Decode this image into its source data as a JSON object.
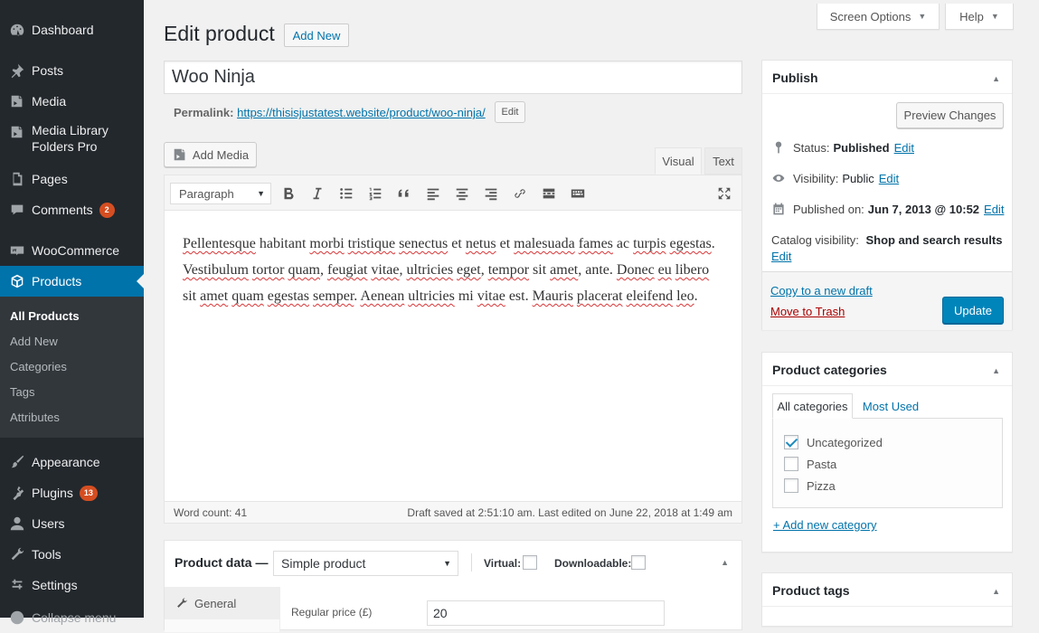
{
  "sidebar": {
    "items": [
      {
        "label": "Dashboard",
        "icon": "dashboard-icon"
      },
      {
        "label": "Posts",
        "icon": "pushpin-icon"
      },
      {
        "label": "Media",
        "icon": "media-icon"
      },
      {
        "label": "Media Library Folders Pro",
        "icon": "media-folders-icon"
      },
      {
        "label": "Pages",
        "icon": "pages-icon"
      },
      {
        "label": "Comments",
        "icon": "comment-icon",
        "badge": "2"
      },
      {
        "label": "WooCommerce",
        "icon": "woocommerce-icon"
      },
      {
        "label": "Products",
        "icon": "products-icon"
      },
      {
        "label": "Appearance",
        "icon": "paintbrush-icon"
      },
      {
        "label": "Plugins",
        "icon": "plugin-icon",
        "badge": "13"
      },
      {
        "label": "Users",
        "icon": "users-icon"
      },
      {
        "label": "Tools",
        "icon": "wrench-icon"
      },
      {
        "label": "Settings",
        "icon": "settings-icon"
      },
      {
        "label": "Collapse menu",
        "icon": "collapse-icon"
      }
    ],
    "media_library_line1": "Media Library",
    "media_library_line2": "Folders Pro",
    "submenu": [
      "All Products",
      "Add New",
      "Categories",
      "Tags",
      "Attributes"
    ]
  },
  "top": {
    "screen_options": "Screen Options",
    "help": "Help"
  },
  "header": {
    "title": "Edit product",
    "add_new": "Add New"
  },
  "post": {
    "title": "Woo Ninja",
    "permalink_label": "Permalink:",
    "permalink_url": "https://thisisjustatest.website/product/woo-ninja/",
    "permalink_edit": "Edit"
  },
  "editor": {
    "add_media": "Add Media",
    "tab_visual": "Visual",
    "tab_text": "Text",
    "format": "Paragraph",
    "word_count": "Word count: 41",
    "draft_saved": "Draft saved at 2:51:10 am. Last edited on June 22, 2018 at 1:49 am"
  },
  "product_data": {
    "title": "Product data —",
    "type": "Simple product",
    "virtual": "Virtual:",
    "downloadable": "Downloadable:",
    "general_tab": "General",
    "regular_price_label": "Regular price (£)",
    "regular_price": "20"
  },
  "publish": {
    "title": "Publish",
    "preview": "Preview Changes",
    "status_label": "Status:",
    "status_value": "Published",
    "visibility_label": "Visibility:",
    "visibility_value": "Public",
    "published_label": "Published on:",
    "published_value": "Jun 7, 2013 @ 10:52",
    "catalog_label": "Catalog visibility:",
    "catalog_value": "Shop and search results",
    "edit": "Edit",
    "copy_draft": "Copy to a new draft",
    "trash": "Move to Trash",
    "update": "Update"
  },
  "categories": {
    "title": "Product categories",
    "tab_all": "All categories",
    "tab_most_used": "Most Used",
    "items": [
      {
        "label": "Uncategorized",
        "checked": true
      },
      {
        "label": "Pasta",
        "checked": false
      },
      {
        "label": "Pizza",
        "checked": false
      }
    ],
    "add_new": "+ Add new category"
  },
  "tags": {
    "title": "Product tags"
  },
  "colors": {
    "sidebar_bg": "#23282d",
    "active_blue": "#0073aa",
    "primary_button": "#0085ba",
    "badge": "#d54e21",
    "trash_link": "#aa0000"
  }
}
